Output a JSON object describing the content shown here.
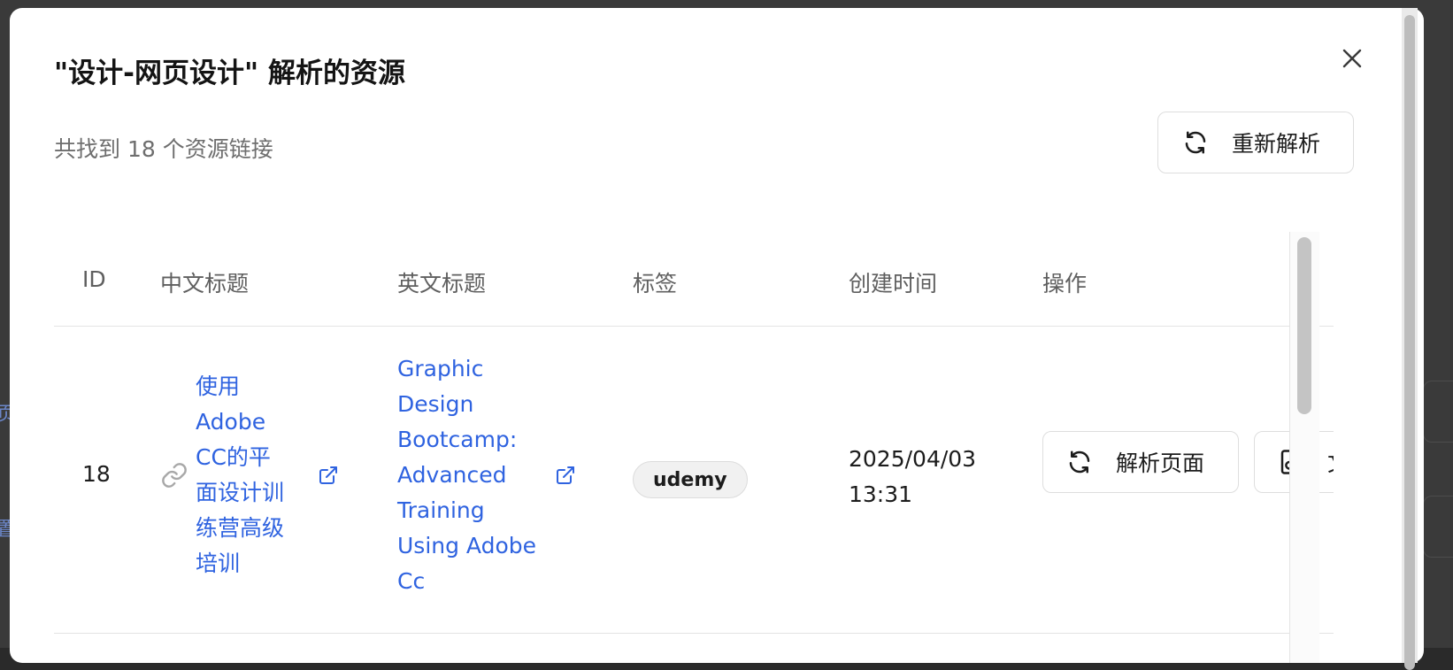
{
  "dialog": {
    "title": "\"设计-网页设计\" 解析的资源",
    "summary": "共找到 18 个资源链接",
    "reparse_label": "重新解析"
  },
  "table": {
    "headers": [
      "ID",
      "中文标题",
      "英文标题",
      "标签",
      "创建时间",
      "操作"
    ],
    "rows": [
      {
        "id": "18",
        "zh_title_lines": [
          "使用",
          "Adobe",
          "CC的平",
          "面设计训",
          "练营高级",
          "培训"
        ],
        "en_title_lines": [
          "Graphic",
          "Design",
          "Bootcamp:",
          "Advanced",
          "Training",
          "Using Adobe",
          "Cc"
        ],
        "tag": "udemy",
        "created_lines": [
          "2025/04/03",
          "13:31"
        ],
        "action_parse_page": "解析页面",
        "action_second": "文"
      }
    ]
  },
  "icons": {
    "close": "close-icon",
    "reparse": "refresh-icon",
    "link": "link-icon",
    "external": "external-link-icon",
    "file_search": "file-search-icon"
  },
  "colors": {
    "link": "#2f63e0",
    "muted_text": "#6e6e6e",
    "border": "#e4e4e4"
  }
}
